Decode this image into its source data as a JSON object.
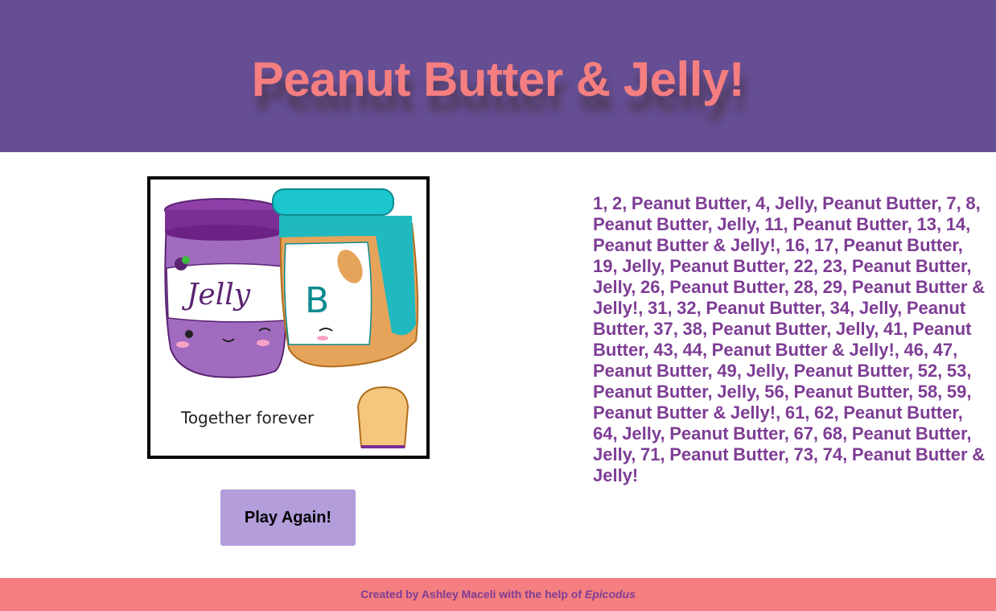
{
  "header": {
    "title": "Peanut Butter & Jelly!"
  },
  "picture": {
    "jelly_label": "Jelly",
    "pb_label": "B",
    "caption": "Together forever"
  },
  "controls": {
    "play_again_label": "Play Again!"
  },
  "results": {
    "text": "1, 2, Peanut Butter, 4, Jelly, Peanut Butter, 7, 8, Peanut Butter, Jelly, 11, Peanut Butter, 13, 14, Peanut Butter & Jelly!, 16, 17, Peanut Butter, 19, Jelly, Peanut Butter, 22, 23, Peanut Butter, Jelly, 26, Peanut Butter, 28, 29, Peanut Butter & Jelly!, 31, 32, Peanut Butter, 34, Jelly, Peanut Butter, 37, 38, Peanut Butter, Jelly, 41, Peanut Butter, 43, 44, Peanut Butter & Jelly!, 46, 47, Peanut Butter, 49, Jelly, Peanut Butter, 52, 53, Peanut Butter, Jelly, 56, Peanut Butter, 58, 59, Peanut Butter & Jelly!, 61, 62, Peanut Butter, 64, Jelly, Peanut Butter, 67, 68, Peanut Butter, Jelly, 71, Peanut Butter, 73, 74, Peanut Butter & Jelly!"
  },
  "footer": {
    "credit_prefix": "Created by Ashley Maceli with the help of ",
    "credit_link": "Epicodus"
  },
  "colors": {
    "header_bg": "#654e93",
    "title": "#f47e80",
    "results_text": "#7e3d95",
    "button_bg": "#b39ddb",
    "footer_bg": "#f47e80"
  }
}
